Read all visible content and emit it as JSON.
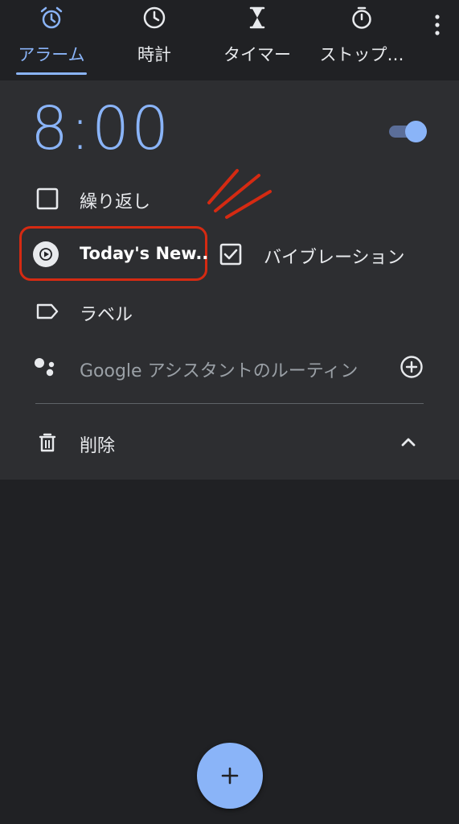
{
  "tabs": [
    {
      "label": "アラーム",
      "icon": "alarm-icon",
      "active": true
    },
    {
      "label": "時計",
      "icon": "clock-icon",
      "active": false
    },
    {
      "label": "タイマー",
      "icon": "hourglass-icon",
      "active": false
    },
    {
      "label": "ストップ…",
      "icon": "stopwatch-icon",
      "active": false
    }
  ],
  "alarm": {
    "time": "8:00",
    "enabled": true,
    "repeat_label": "繰り返し",
    "repeat_checked": false,
    "ringtone_label": "Today's New..",
    "vibration_label": "バイブレーション",
    "vibration_checked": true,
    "label_placeholder": "ラベル",
    "assistant_label": "Google アシスタントのルーティン",
    "delete_label": "削除"
  },
  "colors": {
    "accent": "#8ab4f8",
    "annotation": "#d52a12"
  }
}
